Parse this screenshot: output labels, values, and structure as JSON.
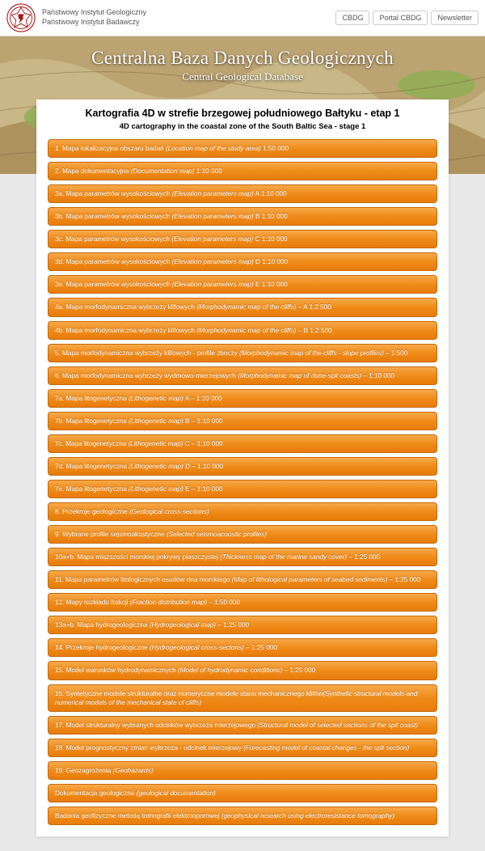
{
  "header": {
    "org_line1": "Państwowy Instytut Geologiczny",
    "org_line2": "Państwowy Instytut Badawczy",
    "nav": [
      "CBDG",
      "Portal CBDG",
      "Newsletter"
    ]
  },
  "banner": {
    "title": "Centralna Baza Danych Geologicznych",
    "subtitle": "Central Geological Database"
  },
  "page": {
    "title": "Kartografia 4D w strefie brzegowej południowego Bałtyku - etap 1",
    "subtitle": "4D cartography in the coastal zone of the South Baltic Sea - stage 1"
  },
  "items": [
    {
      "pl_pre": "1. Mapa lokalizacyjna obszaru badań ",
      "en": "(Location map of the study area)",
      "pl_post": " 1:50 000"
    },
    {
      "pl_pre": "2. Mapa dokumentacyjna ",
      "en": "(Documentation map)",
      "pl_post": " 1:10 000"
    },
    {
      "pl_pre": "3a. Mapa parametrów wysokościowych ",
      "en": "(Elevation parameters map)",
      "pl_post": " A 1:10 000"
    },
    {
      "pl_pre": "3b. Mapa parametrów wysokościowych ",
      "en": "(Elevation parameters map)",
      "pl_post": " B 1:10 000"
    },
    {
      "pl_pre": "3c. Mapa parametrów wysokościowych ",
      "en": "(Elevation parameters map)",
      "pl_post": " C 1:10 000"
    },
    {
      "pl_pre": "3d. Mapa parametrów wysokościowych ",
      "en": "(Elevation parameters map)",
      "pl_post": " D 1:10 000"
    },
    {
      "pl_pre": "3e. Mapa parametrów wysokościowych ",
      "en": "(Elevation parameters map)",
      "pl_post": " E 1:10 000"
    },
    {
      "pl_pre": "4a. Mapa morfodynamiczna wybrzeży klifowych ",
      "en": "(Morphodynamic map of the cliffs)",
      "pl_post": " – A 1:2 500"
    },
    {
      "pl_pre": "4b. Mapa morfodynamiczna wybrzeży klifowych ",
      "en": "(Morphodynamic map of the cliffs)",
      "pl_post": " – B 1:2 500"
    },
    {
      "pl_pre": "5. Mapa morfodynamiczna wybrzeży klifowych - profile zboczy ",
      "en": "(Morphodynamic map of the cliffs - slope profiles)",
      "pl_post": " – 1:500"
    },
    {
      "pl_pre": "6. Mapa morfodynamiczna wybrzeży wydmowo-mierzejowych ",
      "en": "(Morphodynamic map of dune-spit coasts)",
      "pl_post": " – 1:10 000"
    },
    {
      "pl_pre": "7a. Mapa litogenetyczna ",
      "en": "(Lithogenetic map)",
      "pl_post": " A – 1:10 000"
    },
    {
      "pl_pre": "7b. Mapa litogenetyczna ",
      "en": "(Lithogenetic map)",
      "pl_post": " B – 1:10 000"
    },
    {
      "pl_pre": "7c. Mapa litogenetyczna ",
      "en": "(Lithogenetic map)",
      "pl_post": " C – 1:10 000"
    },
    {
      "pl_pre": "7d. Mapa litogenetyczna ",
      "en": "(Lithogenetic map)",
      "pl_post": " D – 1:10 000"
    },
    {
      "pl_pre": "7e. Mapa litogenetyczna ",
      "en": "(Lithogenetic map)",
      "pl_post": " E – 1:10 000"
    },
    {
      "pl_pre": "8. Przekroje geologiczne ",
      "en": "(Geological cross-sections)",
      "pl_post": ""
    },
    {
      "pl_pre": "9. Wybrane profile sejsmoakustyczne ",
      "en": "(Selected seismoacoustic profiles)",
      "pl_post": ""
    },
    {
      "pl_pre": "10a+b. Mapa miąższości morskiej pokrywy piaszczystej ",
      "en": "(Thickness map of the marine sandy cover)",
      "pl_post": " – 1:25 000"
    },
    {
      "pl_pre": "11. Mapa parametrów litologicznych osadów dna morskiego ",
      "en": "(Map of lithological parameters of seabed sediments)",
      "pl_post": " – 1:25 000"
    },
    {
      "pl_pre": "12. Mapy rozkładu frakcji ",
      "en": "(Fraction distribution map)",
      "pl_post": " – 1:50 000"
    },
    {
      "pl_pre": "13a+b. Mapa hydrogeologiczna ",
      "en": "(Hydrogeological map)",
      "pl_post": " – 1:25 000"
    },
    {
      "pl_pre": "14. Przekroje hydrogeologiczne ",
      "en": "(Hydrogeological cross-sectons)",
      "pl_post": " – 1:25 000"
    },
    {
      "pl_pre": "15. Model warunków hydrodynamicznych ",
      "en": "(Model of hydrodynamic conditions)",
      "pl_post": " – 1:25 000"
    },
    {
      "pl_pre": "16. Syntetyczne modele strukturalne oraz numeryczne modele stanu mechanicznego klifów",
      "en": "(Synthetic structural models and numerical models of the mechanical state of cliffs)",
      "pl_post": ""
    },
    {
      "pl_pre": "17. Model strukturalny wybranych odcinków wybrzeża mierzejowego ",
      "en": "(Structural model of selected sections of the spit coast)",
      "pl_post": ""
    },
    {
      "pl_pre": "18. Model prognostyczny zmian wybrzeża - odcinek mierzejowy ",
      "en": "(Forecasting model of coastal changes - the spit section)",
      "pl_post": ""
    },
    {
      "pl_pre": "19. Geozagrożenia ",
      "en": "(Geohazards)",
      "pl_post": ""
    },
    {
      "pl_pre": "Dokumentacja geologiczna ",
      "en": "(geological documentation)",
      "pl_post": ""
    },
    {
      "pl_pre": "Badania geofizyczne metodą tomografii elektrooporowej ",
      "en": "(geophysical research using electroresistance tomography)",
      "pl_post": ""
    }
  ]
}
